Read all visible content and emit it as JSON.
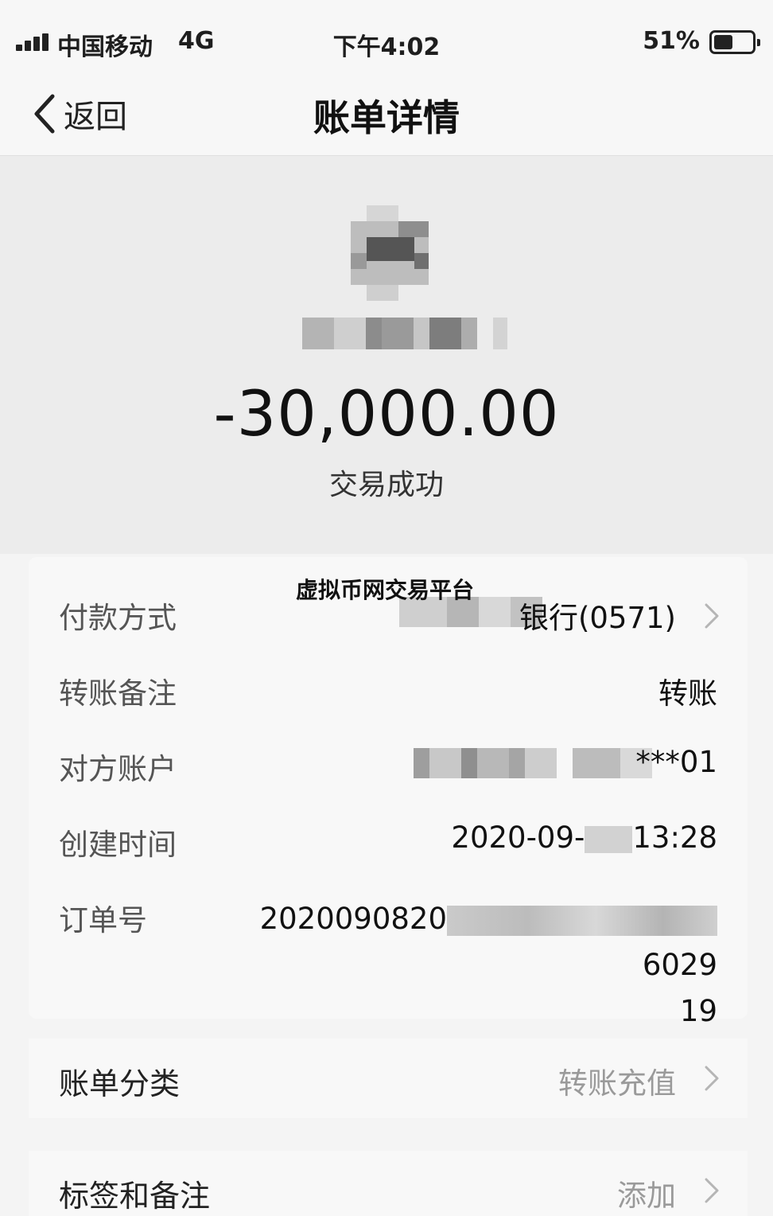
{
  "status_bar": {
    "carrier": "中国移动",
    "network": "4G",
    "time": "下午4:02",
    "battery_text": "51%",
    "battery_level": 0.51
  },
  "nav": {
    "back_label": "返回",
    "title": "账单详情"
  },
  "summary": {
    "amount": "-30,000.00",
    "status": "交易成功"
  },
  "watermark": "虚拟币网交易平台",
  "details": {
    "payment_method": {
      "label": "付款方式",
      "value": "银行(0571)"
    },
    "transfer_note": {
      "label": "转账备注",
      "value": "转账"
    },
    "counterparty": {
      "label": "对方账户",
      "value": "***01"
    },
    "created_time": {
      "label": "创建时间",
      "value_start": "2020-09-",
      "value_end": "13:28"
    },
    "order_number": {
      "label": "订单号",
      "value_start": "2020090820",
      "value_end": "6029",
      "value_line2": "19"
    }
  },
  "bill_category": {
    "label": "账单分类",
    "value": "转账充值"
  },
  "tags_notes": {
    "label": "标签和备注",
    "value": "添加"
  },
  "colors": {
    "background": "#f4f4f4",
    "card": "#f8f8f8",
    "muted_text": "#9a9a9a"
  }
}
